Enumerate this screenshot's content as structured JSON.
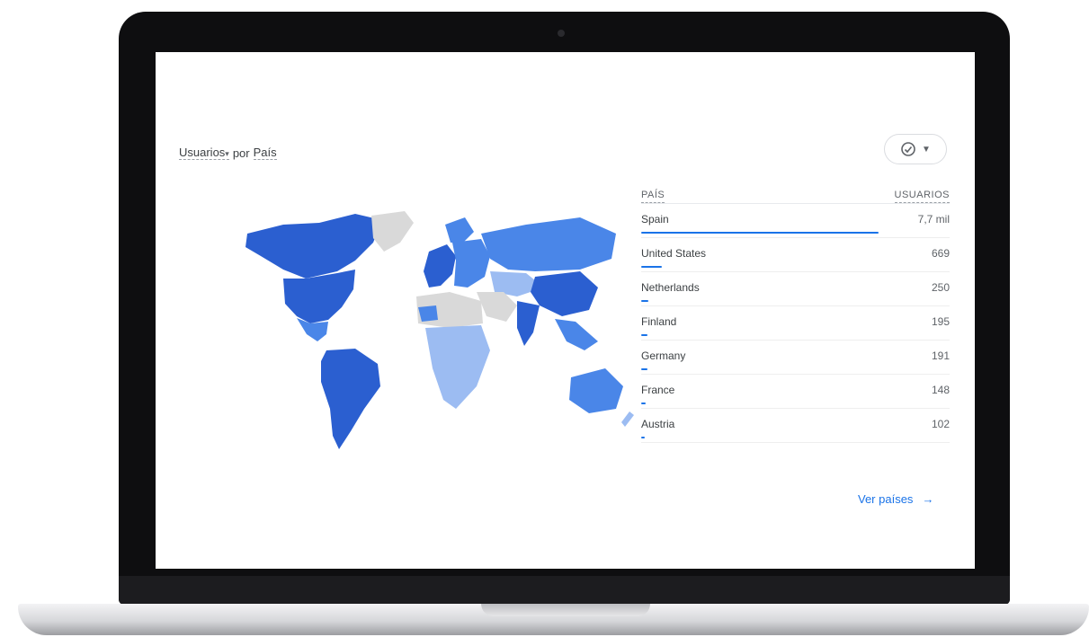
{
  "card": {
    "metric_label": "Usuarios",
    "dimension_prefix": "por",
    "dimension_label": "País"
  },
  "compare": {
    "icon": "check-circle-icon",
    "caret_icon": "caret-down-icon"
  },
  "table": {
    "col_country": "PAÍS",
    "col_users": "USUARIOS",
    "rows": [
      {
        "country": "Spain",
        "users": "7,7 mil",
        "share": 1.0
      },
      {
        "country": "United States",
        "users": "669",
        "share": 0.087
      },
      {
        "country": "Netherlands",
        "users": "250",
        "share": 0.032
      },
      {
        "country": "Finland",
        "users": "195",
        "share": 0.025
      },
      {
        "country": "Germany",
        "users": "191",
        "share": 0.025
      },
      {
        "country": "France",
        "users": "148",
        "share": 0.019
      },
      {
        "country": "Austria",
        "users": "102",
        "share": 0.013
      }
    ]
  },
  "link": {
    "label": "Ver países",
    "icon": "arrow-right-icon"
  },
  "colors": {
    "accent": "#1a73e8",
    "map_dark": "#2b5fd0",
    "map_mid": "#4a86e8",
    "map_light": "#9cbcf2",
    "map_none": "#d9d9d9"
  }
}
